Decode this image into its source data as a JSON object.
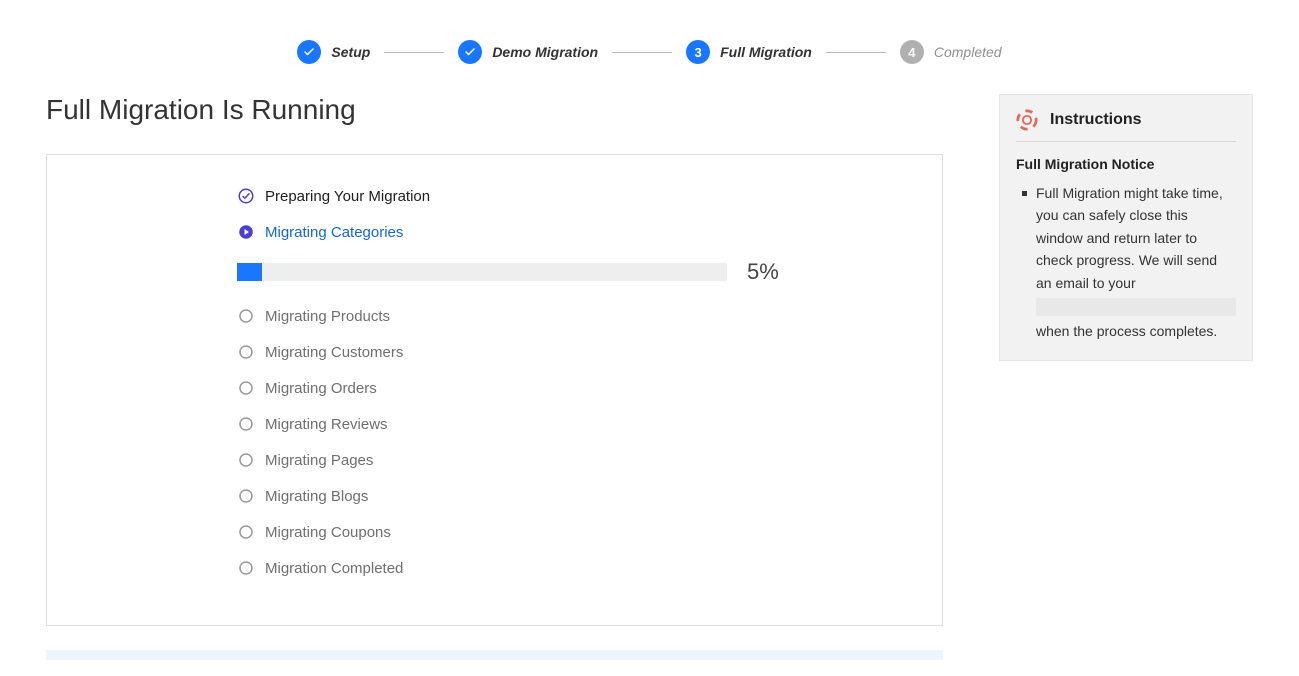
{
  "stepper": {
    "steps": [
      {
        "label": "Setup",
        "state": "done"
      },
      {
        "label": "Demo Migration",
        "state": "done"
      },
      {
        "label": "Full Migration",
        "state": "active",
        "number": "3"
      },
      {
        "label": "Completed",
        "state": "pending",
        "number": "4"
      }
    ]
  },
  "page_title": "Full Migration Is Running",
  "tasks": [
    {
      "label": "Preparing Your Migration",
      "state": "done"
    },
    {
      "label": "Migrating Categories",
      "state": "active",
      "progress_pct": 5,
      "progress_label": "5%"
    },
    {
      "label": "Migrating Products",
      "state": "pending"
    },
    {
      "label": "Migrating Customers",
      "state": "pending"
    },
    {
      "label": "Migrating Orders",
      "state": "pending"
    },
    {
      "label": "Migrating Reviews",
      "state": "pending"
    },
    {
      "label": "Migrating Pages",
      "state": "pending"
    },
    {
      "label": "Migrating Blogs",
      "state": "pending"
    },
    {
      "label": "Migrating Coupons",
      "state": "pending"
    },
    {
      "label": "Migration Completed",
      "state": "pending"
    }
  ],
  "sidebar": {
    "title": "Instructions",
    "subtitle": "Full Migration Notice",
    "notice_part1": "Full Migration might take time, you can safely close this window and return later to check progress. We will send an email to your",
    "notice_part2": "when the process completes."
  }
}
